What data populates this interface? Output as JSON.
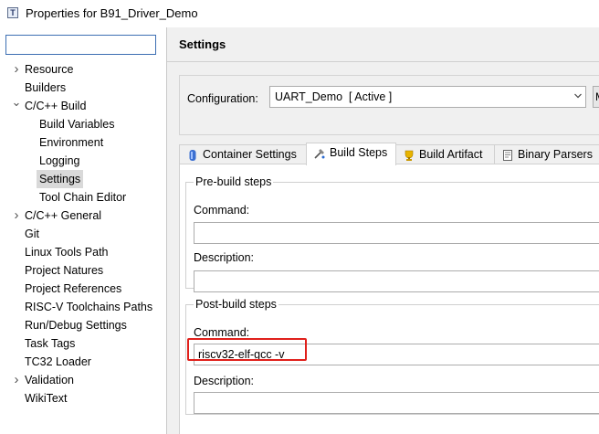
{
  "window": {
    "title": "Properties for B91_Driver_Demo",
    "icon": "properties-icon"
  },
  "filter": {
    "value": ""
  },
  "tree": [
    {
      "label": "Resource",
      "expander": "collapsed"
    },
    {
      "label": "Builders",
      "expander": "none"
    },
    {
      "label": "C/C++ Build",
      "expander": "expanded"
    },
    {
      "label": "Build Variables",
      "expander": "none"
    },
    {
      "label": "Environment",
      "expander": "none"
    },
    {
      "label": "Logging",
      "expander": "none"
    },
    {
      "label": "Settings",
      "expander": "none",
      "selected": true
    },
    {
      "label": "Tool Chain Editor",
      "expander": "none"
    },
    {
      "label": "C/C++ General",
      "expander": "collapsed"
    },
    {
      "label": "Git",
      "expander": "none"
    },
    {
      "label": "Linux Tools Path",
      "expander": "none"
    },
    {
      "label": "Project Natures",
      "expander": "none"
    },
    {
      "label": "Project References",
      "expander": "none"
    },
    {
      "label": "RISC-V Toolchains Paths",
      "expander": "none"
    },
    {
      "label": "Run/Debug Settings",
      "expander": "none"
    },
    {
      "label": "Task Tags",
      "expander": "none"
    },
    {
      "label": "TC32 Loader",
      "expander": "none"
    },
    {
      "label": "Validation",
      "expander": "collapsed"
    },
    {
      "label": "WikiText",
      "expander": "none"
    }
  ],
  "settings": {
    "title": "Settings",
    "configuration_label": "Configuration:",
    "configuration_value": "UART_Demo  [ Active ]",
    "configuration_button_label": "M"
  },
  "tabs": [
    {
      "label": "Container Settings",
      "icon": "container-icon"
    },
    {
      "label": "Build Steps",
      "icon": "build-steps-icon",
      "active": true
    },
    {
      "label": "Build Artifact",
      "icon": "artifact-icon"
    },
    {
      "label": "Binary Parsers",
      "icon": "binary-parsers-icon"
    }
  ],
  "pre_build": {
    "title": "Pre-build steps",
    "command_label": "Command:",
    "command_value": "",
    "description_label": "Description:",
    "description_value": ""
  },
  "post_build": {
    "title": "Post-build steps",
    "command_label": "Command:",
    "command_value": "riscv32-elf-gcc -v",
    "description_label": "Description:",
    "description_value": ""
  },
  "colors": {
    "highlight": "#e0201b",
    "selection": "#d9d9d9",
    "focus_border": "#3d6fb3"
  }
}
